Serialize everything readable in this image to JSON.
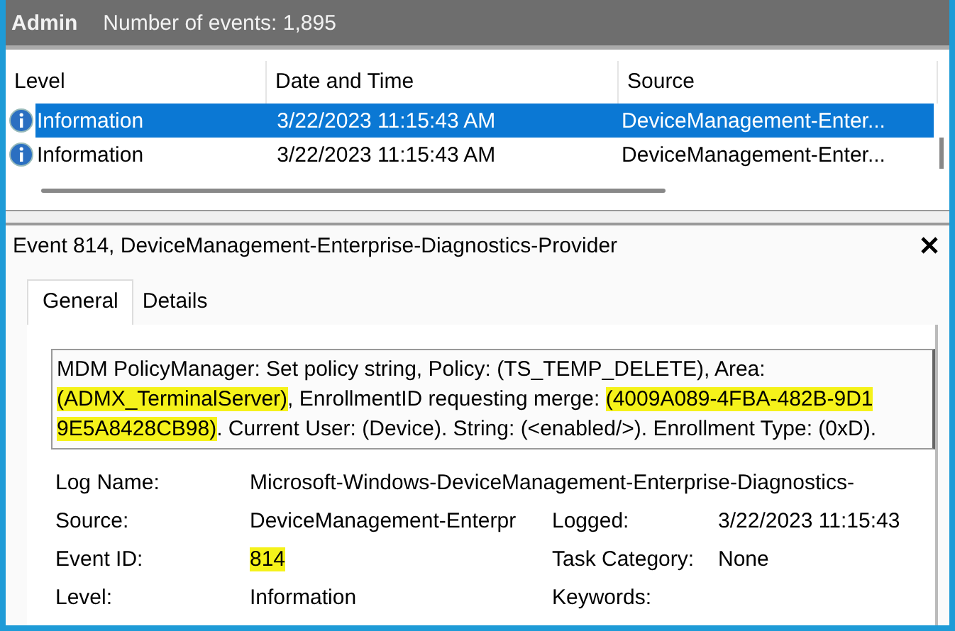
{
  "header": {
    "log": "Admin",
    "count": "Number of events: 1,895"
  },
  "table": {
    "columns": [
      "Level",
      "Date and Time",
      "Source"
    ],
    "rows": [
      {
        "selected": true,
        "level": "Information",
        "date": "3/22/2023 11:15:43 AM",
        "source": "DeviceManagement-Enter..."
      },
      {
        "selected": false,
        "level": "Information",
        "date": "3/22/2023 11:15:43 AM",
        "source": "DeviceManagement-Enter..."
      }
    ]
  },
  "detail": {
    "title": "Event 814, DeviceManagement-Enterprise-Diagnostics-Provider",
    "tabs": [
      {
        "label": "General",
        "selected": true
      },
      {
        "label": "Details",
        "selected": false
      }
    ],
    "description": [
      [
        {
          "text": "MDM PolicyManager: Set policy string, Policy: (TS_TEMP_DELETE), Area:",
          "highlighted": false
        }
      ],
      [
        {
          "text": "(ADMX_TerminalServer)",
          "highlighted": true
        },
        {
          "text": ", EnrollmentID requesting merge: ",
          "highlighted": false
        },
        {
          "text": "(4009A089-4FBA-482B-9D1",
          "highlighted": true
        }
      ],
      [
        {
          "text": "9E5A8428CB98)",
          "highlighted": true
        },
        {
          "text": ". Current User: (Device). String: (<enabled/>). Enrollment Type: (0xD).",
          "highlighted": false
        }
      ]
    ],
    "fields": [
      [
        {
          "label": "Log Name:",
          "value": "Microsoft-Windows-DeviceManagement-Enterprise-Diagnostics-",
          "highlighted": false
        }
      ],
      [
        {
          "label": "Source:",
          "value": "DeviceManagement-Enterpr",
          "highlighted": false
        },
        {
          "label": "Logged:",
          "value": "3/22/2023 11:15:43",
          "highlighted": false
        }
      ],
      [
        {
          "label": "Event ID:",
          "value": "814",
          "highlighted": true
        },
        {
          "label": "Task Category:",
          "value": "None",
          "highlighted": false
        }
      ],
      [
        {
          "label": "Level:",
          "value": "Information",
          "highlighted": false
        },
        {
          "label": "Keywords:"
        }
      ]
    ]
  }
}
